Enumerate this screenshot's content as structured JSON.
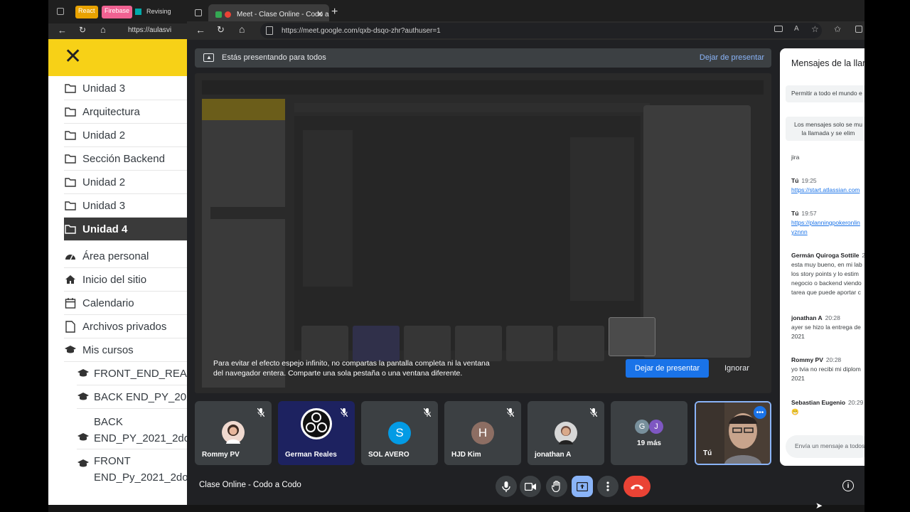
{
  "background_browser": {
    "tabs": [
      "React",
      "Firebase",
      "Revising"
    ],
    "url_partial": "https://aulasvi"
  },
  "sidebar": {
    "close_label": "✕",
    "items": [
      {
        "label": "Unidad 3",
        "icon": "folder-icon"
      },
      {
        "label": "Arquitectura",
        "icon": "folder-icon"
      },
      {
        "label": "Unidad 2",
        "icon": "folder-icon"
      },
      {
        "label": "Sección Backend",
        "icon": "folder-icon"
      },
      {
        "label": "Unidad 2",
        "icon": "folder-icon"
      },
      {
        "label": "Unidad 3",
        "icon": "folder-icon"
      },
      {
        "label": "Unidad 4",
        "icon": "folder-icon",
        "active": true
      },
      {
        "label": "Área personal",
        "icon": "dashboard-icon"
      },
      {
        "label": "Inicio del sitio",
        "icon": "home-icon"
      },
      {
        "label": "Calendario",
        "icon": "calendar-icon"
      },
      {
        "label": "Archivos privados",
        "icon": "file-icon"
      },
      {
        "label": "Mis cursos",
        "icon": "graduation-cap-icon"
      },
      {
        "label": "FRONT_END_REACT",
        "icon": "graduation-cap-icon"
      },
      {
        "label": "BACK END_PY_2021",
        "icon": "graduation-cap-icon"
      },
      {
        "label_line1": "BACK",
        "label_line2": "END_PY_2021_2doC",
        "icon": "graduation-cap-icon"
      },
      {
        "label_line1": "FRONT",
        "label_line2": "END_Py_2021_2doC",
        "icon": "graduation-cap-icon"
      }
    ]
  },
  "browser": {
    "tab_title": "Meet - Clase Online - Codo a",
    "new_tab": "+",
    "url": "https://meet.google.com/qxb-dsqo-zhr?authuser=1"
  },
  "presenting": {
    "banner_text": "Estás presentando para todos",
    "stop_label": "Dejar de presentar",
    "warning": "Para evitar el efecto espejo infinito, no compartas la pantalla completa ni la ventana del navegador entera. Comparte una sola pestaña o una ventana diferente.",
    "warning_line1": "Para evitar el efecto espejo infinito, no compartas la pantalla completa ni la ventana",
    "warning_line2": "del navegador entera. Comparte una sola pestaña o una ventana diferente.",
    "stop_button": "Dejar de presentar",
    "ignore_button": "Ignorar"
  },
  "participants": [
    {
      "name": "Rommy PV",
      "avatar": "photo",
      "muted": true
    },
    {
      "name": "German Reales",
      "avatar": "obs-logo",
      "muted": true
    },
    {
      "name": "SOL AVERO",
      "avatar": "S",
      "color": "#039be5",
      "muted": true
    },
    {
      "name": "HJD Kim",
      "avatar": "H",
      "color": "#8d6e63",
      "muted": true
    },
    {
      "name": "jonathan A",
      "avatar": "photo",
      "muted": true
    },
    {
      "name": "19 más",
      "avatar_letters": [
        "G",
        "J"
      ],
      "colors": [
        "#78909c",
        "#7e57c2"
      ]
    },
    {
      "name": "Tú",
      "avatar": "video",
      "self": true
    }
  ],
  "meeting_title": "Clase Online - Codo a Codo",
  "colors": {
    "accent": "#1a73e8",
    "hangup": "#ea4335",
    "present_active": "#8ab4f8",
    "sidebar_head": "#f7d117"
  },
  "chat": {
    "title": "Mensajes de la llam",
    "permit_label": "Permitir a todo el mundo e",
    "notice_line1": "Los mensajes solo se mu",
    "notice_line2": "la llamada y se elim",
    "jira": "jira",
    "messages": [
      {
        "name": "Tú",
        "time": "19:25",
        "link": "https://start.atlassian.com"
      },
      {
        "name": "Tú",
        "time": "19:57",
        "link_line1": "https://planningpokeronlin",
        "link_line2": "yznnn"
      },
      {
        "name": "Germán Quiroga Sottile",
        "time": "2",
        "lines": [
          "esta muy bueno, en mi lab",
          "los story points y lo estim",
          "negocio o backend viendo",
          "tarea que puede aportar c"
        ]
      },
      {
        "name": "jonathan A",
        "time": "20:28",
        "lines": [
          "ayer se hizo la entrega de",
          "2021"
        ]
      },
      {
        "name": "Rommy PV",
        "time": "20:28",
        "lines": [
          "yo tvia no recibi mi diplom",
          "2021"
        ]
      },
      {
        "name": "Sebastian Eugenio",
        "time": "20:29",
        "lines": [
          "😁"
        ]
      }
    ],
    "input_placeholder": "Envía un mensaje a todos"
  }
}
